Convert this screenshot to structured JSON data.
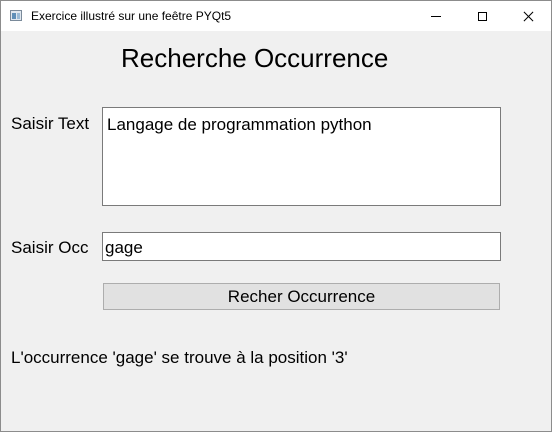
{
  "window": {
    "title": "Exercice illustré sur une feêtre PYQt5"
  },
  "main": {
    "heading": "Recherche Occurrence",
    "text_label": "Saisir Text",
    "text_value": "Langage de programmation python",
    "occ_label": "Saisir Occ",
    "occ_value": "gage",
    "button_label": "Recher Occurrence",
    "result": "L'occurrence 'gage' se trouve à la position '3'"
  }
}
